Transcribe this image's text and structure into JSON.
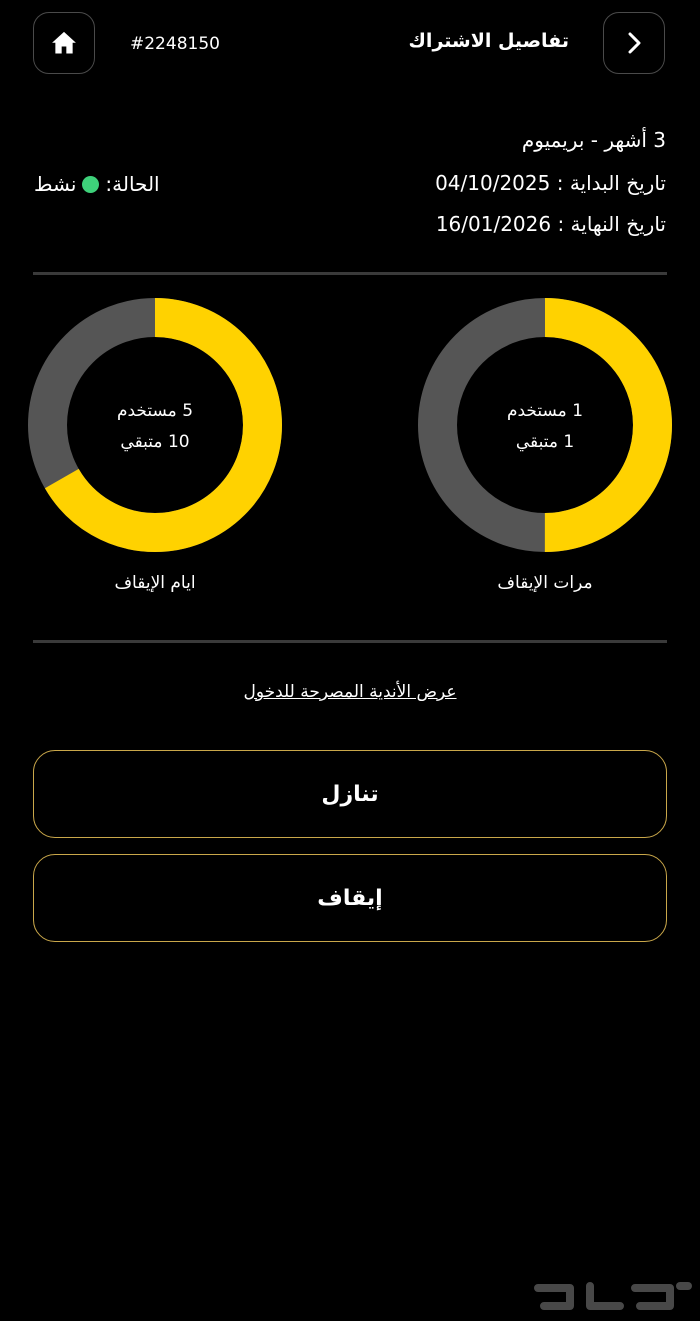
{
  "header": {
    "title": "تفاصيل الاشتراك",
    "subscription_id": "#2248150",
    "home_icon": "home-icon",
    "back_icon": "chevron-right-icon"
  },
  "subscription": {
    "plan": "3 أشهر - بريميوم",
    "start_date": "تاريخ البداية : 04/10/2025",
    "end_date": "تاريخ النهاية : 16/01/2026",
    "status_label": "الحالة:",
    "status_value": "نشط",
    "status_color": "#3ed17a"
  },
  "freeze_count": {
    "label": "مرات الإيقاف",
    "used": "1 مستخدم",
    "remaining": "1 متبقي",
    "used_value": 1,
    "total_value": 2
  },
  "freeze_days": {
    "label": "ايام الإيقاف",
    "used": "5 مستخدم",
    "remaining": "10 متبقي",
    "used_value": 5,
    "total_value": 15
  },
  "colors": {
    "accent": "#ffd200",
    "track": "#555555",
    "button_border": "#c9a74a"
  },
  "links": {
    "allowed_clubs": "عرض الأندية المصرحة للدخول"
  },
  "actions": {
    "transfer": "تنازل",
    "freeze": "إيقاف"
  }
}
